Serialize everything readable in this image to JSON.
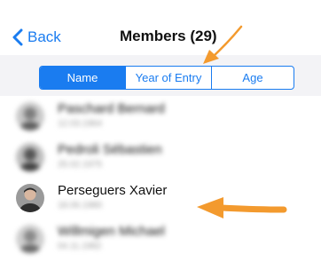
{
  "navbar": {
    "back_label": "Back",
    "title": "Members (29)"
  },
  "segments": [
    {
      "label": "Name",
      "selected": true
    },
    {
      "label": "Year of Entry",
      "selected": false
    },
    {
      "label": "Age",
      "selected": false
    }
  ],
  "members": [
    {
      "name": "Paschard Bernard",
      "date": "12.03.1964",
      "blurred": true
    },
    {
      "name": "Pedroli Sébastien",
      "date": "25.02.1975",
      "blurred": true
    },
    {
      "name": "Perseguers Xavier",
      "date": "18.06.1980",
      "blurred": false
    },
    {
      "name": "Willmigen Michael",
      "date": "04.11.1982",
      "blurred": true
    }
  ],
  "colors": {
    "accent": "#1a7cf0",
    "annotation_arrow": "#f39a2e",
    "segment_background": "#f3f3f6"
  }
}
